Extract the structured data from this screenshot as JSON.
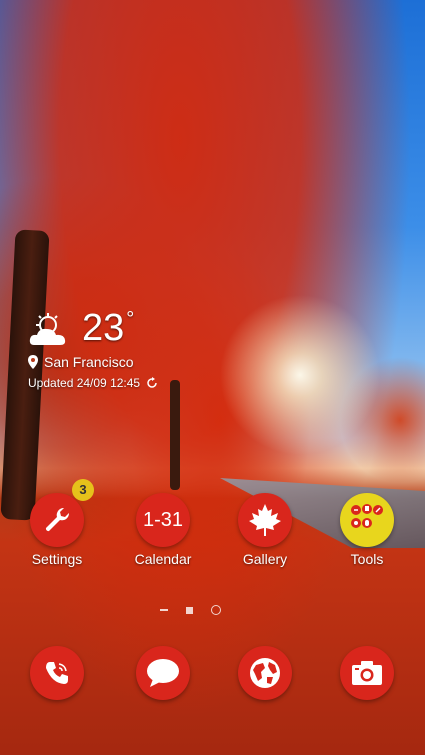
{
  "weather": {
    "temperature": "23",
    "degree_symbol": "°",
    "location": "San Francisco",
    "updated": "Updated 24/09 12:45"
  },
  "apps": [
    {
      "name": "Settings",
      "badge": "3"
    },
    {
      "name": "Calendar",
      "icon_text": "1-31"
    },
    {
      "name": "Gallery"
    },
    {
      "name": "Tools"
    }
  ],
  "dock": [
    "phone-icon",
    "messages-icon",
    "browser-globe-icon",
    "camera-icon"
  ],
  "colors": {
    "icon_red": "#d9261c",
    "tools_yellow": "#e8d61d",
    "badge": "#e6c21b"
  }
}
